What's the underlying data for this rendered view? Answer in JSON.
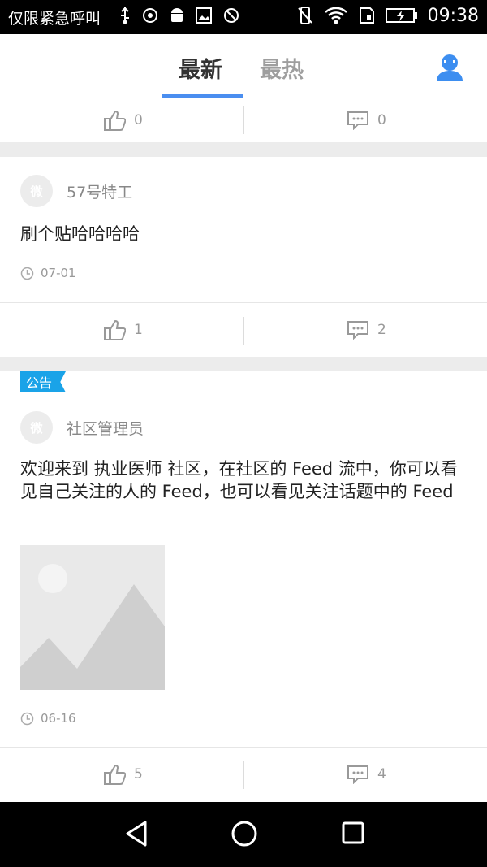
{
  "status_bar": {
    "carrier": "仅限紧急呼叫",
    "time": "09:38",
    "icons": [
      "usb-icon",
      "sync-icon",
      "android-icon",
      "image-icon",
      "no-sim-icon",
      "vibrate-icon",
      "wifi-icon",
      "sim-icon",
      "battery-icon"
    ]
  },
  "tabs": [
    {
      "label": "最新",
      "active": true
    },
    {
      "label": "最热",
      "active": false
    }
  ],
  "accent_color": "#4a8ef0",
  "feed": {
    "first_actions": {
      "likes": "0",
      "comments": "0"
    },
    "posts": [
      {
        "author": "57号特工",
        "avatar_text": "微",
        "text": "刷个贴哈哈哈哈",
        "date": "07-01",
        "likes": "1",
        "comments": "2"
      },
      {
        "badge": "公告",
        "author": "社区管理员",
        "avatar_text": "微",
        "text": "欢迎来到 执业医师 社区，在社区的 Feed 流中，你可以看见自己关注的人的 Feed，也可以看见关注话题中的 Feed",
        "date": "06-16",
        "likes": "5",
        "comments": "4"
      }
    ]
  }
}
